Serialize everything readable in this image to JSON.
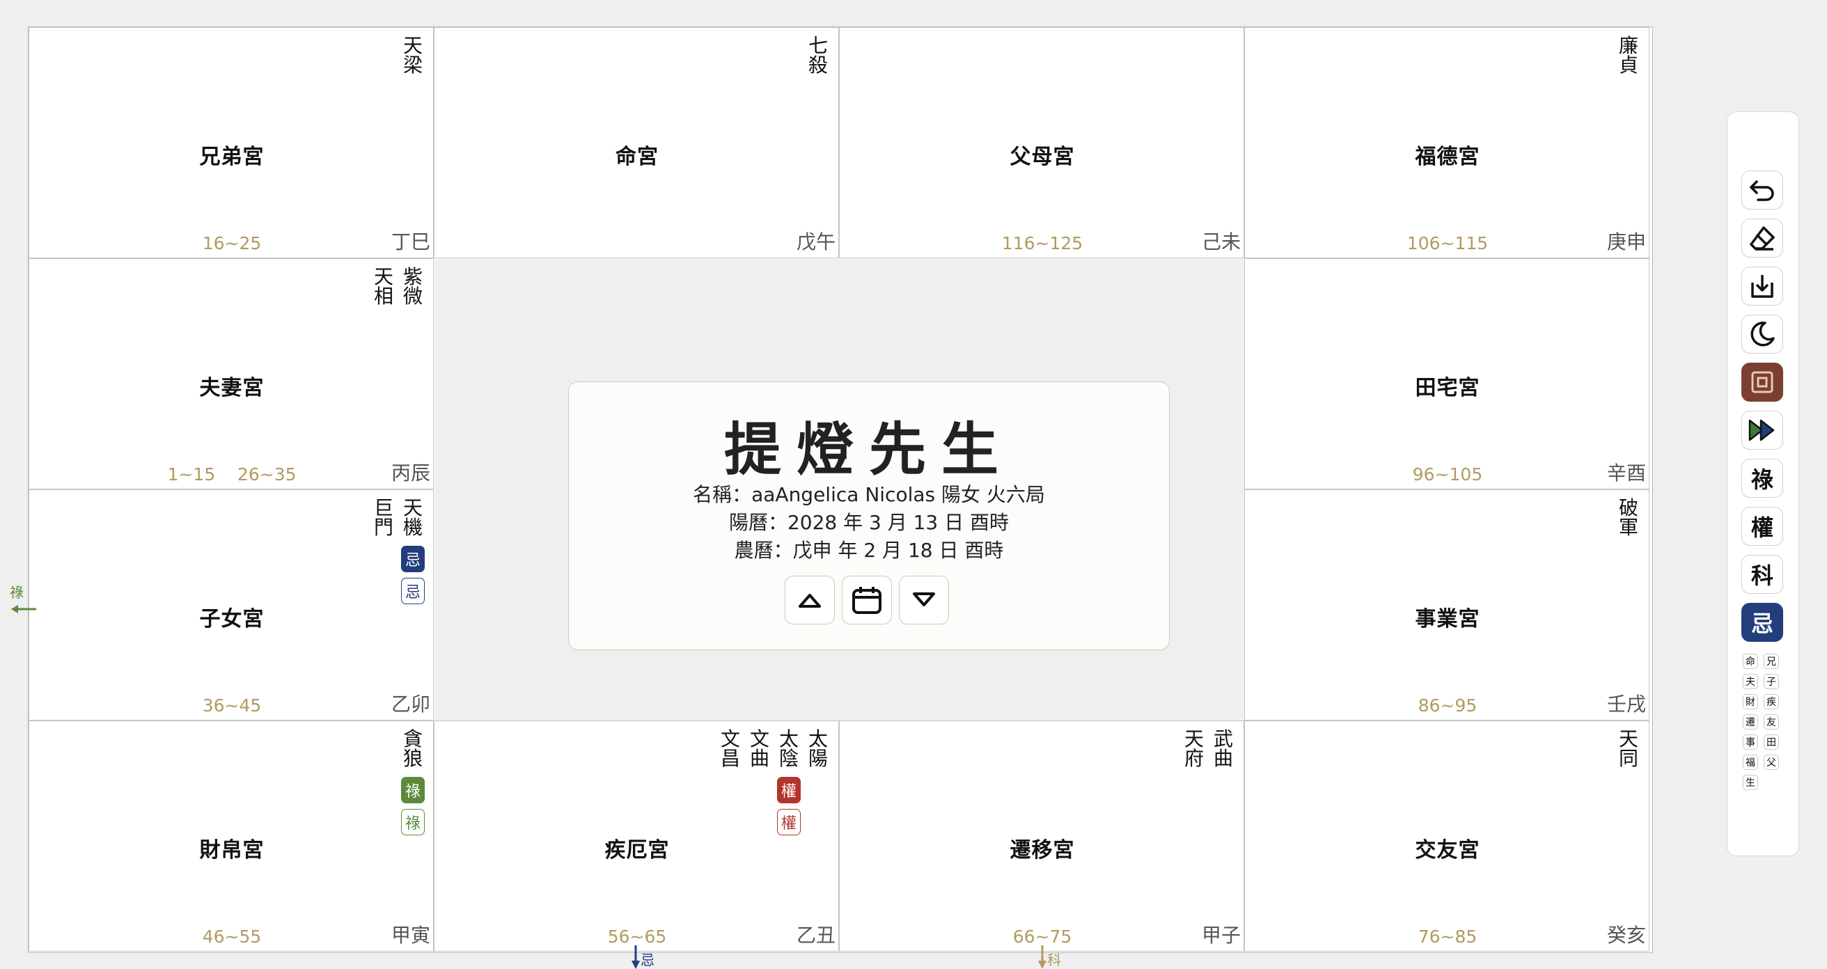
{
  "palaces": [
    {
      "name": "兄弟宮",
      "ages": "16~25",
      "ganzhi": "丁巳",
      "stars": [
        {
          "name": "天梁"
        }
      ]
    },
    {
      "name": "命宮",
      "ages": "",
      "ganzhi": "戊午",
      "stars": [
        {
          "name": "七殺"
        }
      ]
    },
    {
      "name": "父母宮",
      "ages": "116~125",
      "ganzhi": "己未",
      "stars": []
    },
    {
      "name": "福德宮",
      "ages": "106~115",
      "ganzhi": "庚申",
      "stars": [
        {
          "name": "廉貞"
        }
      ]
    },
    {
      "name": "夫妻宮",
      "ages": "1~15    26~35",
      "ganzhi": "丙辰",
      "stars": [
        {
          "name": "紫微"
        },
        {
          "name": "天相"
        }
      ]
    },
    {
      "name": "田宅宮",
      "ages": "96~105",
      "ganzhi": "辛酉",
      "stars": []
    },
    {
      "name": "子女宮",
      "ages": "36~45",
      "ganzhi": "乙卯",
      "stars": [
        {
          "name": "天機",
          "badges": [
            {
              "text": "忌",
              "kind": "ji"
            },
            {
              "text": "忌",
              "kind": "ji o"
            }
          ]
        },
        {
          "name": "巨門"
        }
      ]
    },
    {
      "name": "事業宮",
      "ages": "86~95",
      "ganzhi": "壬戌",
      "stars": [
        {
          "name": "破軍"
        }
      ]
    },
    {
      "name": "財帛宮",
      "ages": "46~55",
      "ganzhi": "甲寅",
      "stars": [
        {
          "name": "貪狼",
          "badges": [
            {
              "text": "祿",
              "kind": "lu"
            },
            {
              "text": "祿",
              "kind": "lu o"
            }
          ]
        }
      ]
    },
    {
      "name": "疾厄宮",
      "ages": "56~65",
      "ganzhi": "乙丑",
      "stars": [
        {
          "name": "太陽"
        },
        {
          "name": "太陰",
          "badges": [
            {
              "text": "權",
              "kind": "quan"
            },
            {
              "text": "權",
              "kind": "quan o"
            }
          ]
        },
        {
          "name": "文曲"
        },
        {
          "name": "文昌"
        }
      ]
    },
    {
      "name": "遷移宮",
      "ages": "66~75",
      "ganzhi": "甲子",
      "stars": [
        {
          "name": "武曲"
        },
        {
          "name": "天府"
        }
      ]
    },
    {
      "name": "交友宮",
      "ages": "76~85",
      "ganzhi": "癸亥",
      "stars": [
        {
          "name": "天同"
        }
      ]
    }
  ],
  "center": {
    "title": "提燈先生",
    "line1": "名稱：aaAngelica Nicolas     陽女  火六局",
    "line2": "陽曆：2028 年 3 月 13 日 酉時",
    "line3": "農曆：戊申 年 2 月 18 日 酉時"
  },
  "toolbar": {
    "lu": "祿",
    "quan": "權",
    "ke": "科",
    "ji": "忌",
    "mini": [
      "命",
      "兄",
      "夫",
      "子",
      "財",
      "疾",
      "遷",
      "友",
      "事",
      "田",
      "福",
      "父",
      "生"
    ]
  },
  "annotations": {
    "left": "祿",
    "bottom1": "忌",
    "bottom2": "科"
  },
  "colors": {
    "lu": "#5c8a3a",
    "quan": "#b3342a",
    "ji": "#223e7c",
    "ke": "#b29a62",
    "age": "#b29a62"
  }
}
